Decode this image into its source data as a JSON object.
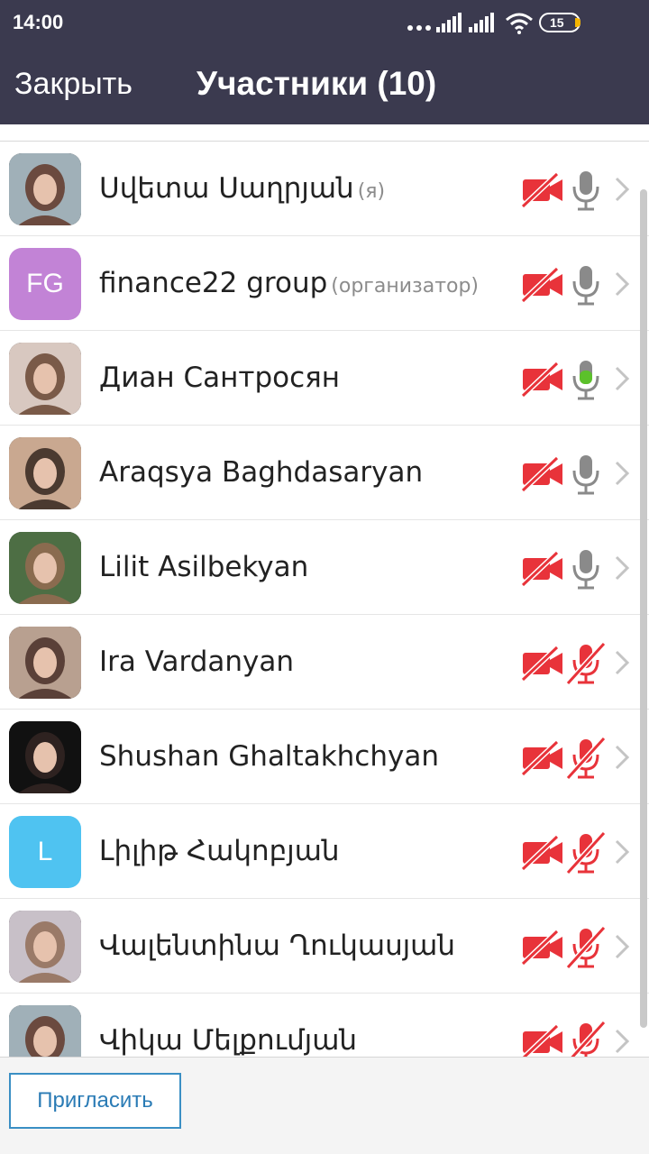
{
  "status_bar": {
    "time": "14:00",
    "battery": "15",
    "icons": [
      "dots-icon",
      "signal-icon",
      "signal-icon",
      "wifi-icon",
      "battery-icon"
    ]
  },
  "header": {
    "close_label": "Закрыть",
    "title": "Участники (10)"
  },
  "participants": [
    {
      "name": "Սվետա Սաղրյան",
      "tag": "(я)",
      "avatar": "photo",
      "video": "off",
      "audio": "on-idle"
    },
    {
      "name": "finance22 group",
      "tag": "(организатор)",
      "avatar": "initials",
      "initials": "FG",
      "avatar_color": "#c283d6",
      "video": "off",
      "audio": "on-idle"
    },
    {
      "name": "Диан Сантросян",
      "tag": "",
      "avatar": "photo",
      "video": "off",
      "audio": "speaking"
    },
    {
      "name": "Araqsya Baghdasaryan",
      "tag": "",
      "avatar": "photo",
      "video": "off",
      "audio": "on-idle"
    },
    {
      "name": "Lilit Asilbekyan",
      "tag": "",
      "avatar": "photo",
      "video": "off",
      "audio": "on-idle"
    },
    {
      "name": "Ira Vardanyan",
      "tag": "",
      "avatar": "photo",
      "video": "off",
      "audio": "muted"
    },
    {
      "name": "Shushan Ghaltakhchyan",
      "tag": "",
      "avatar": "photo",
      "video": "off",
      "audio": "muted"
    },
    {
      "name": "Լիլիթ Հակոբյան",
      "tag": "",
      "avatar": "initials",
      "initials": "L",
      "avatar_color": "#4fc3f1",
      "video": "off",
      "audio": "muted"
    },
    {
      "name": "Վալենտինա Ղուկասյան",
      "tag": "",
      "avatar": "photo",
      "video": "off",
      "audio": "muted"
    },
    {
      "name": "Վիկա Մելքումյան",
      "tag": "",
      "avatar": "photo",
      "video": "off",
      "audio": "muted"
    }
  ],
  "footer": {
    "invite_label": "Пригласить"
  },
  "colors": {
    "header_bg": "#3b3a4f",
    "muted_red": "#e8333a",
    "mic_idle": "#8a8a8a",
    "mic_speaking": "#5cc12b",
    "invite_blue": "#2a7bb5"
  }
}
